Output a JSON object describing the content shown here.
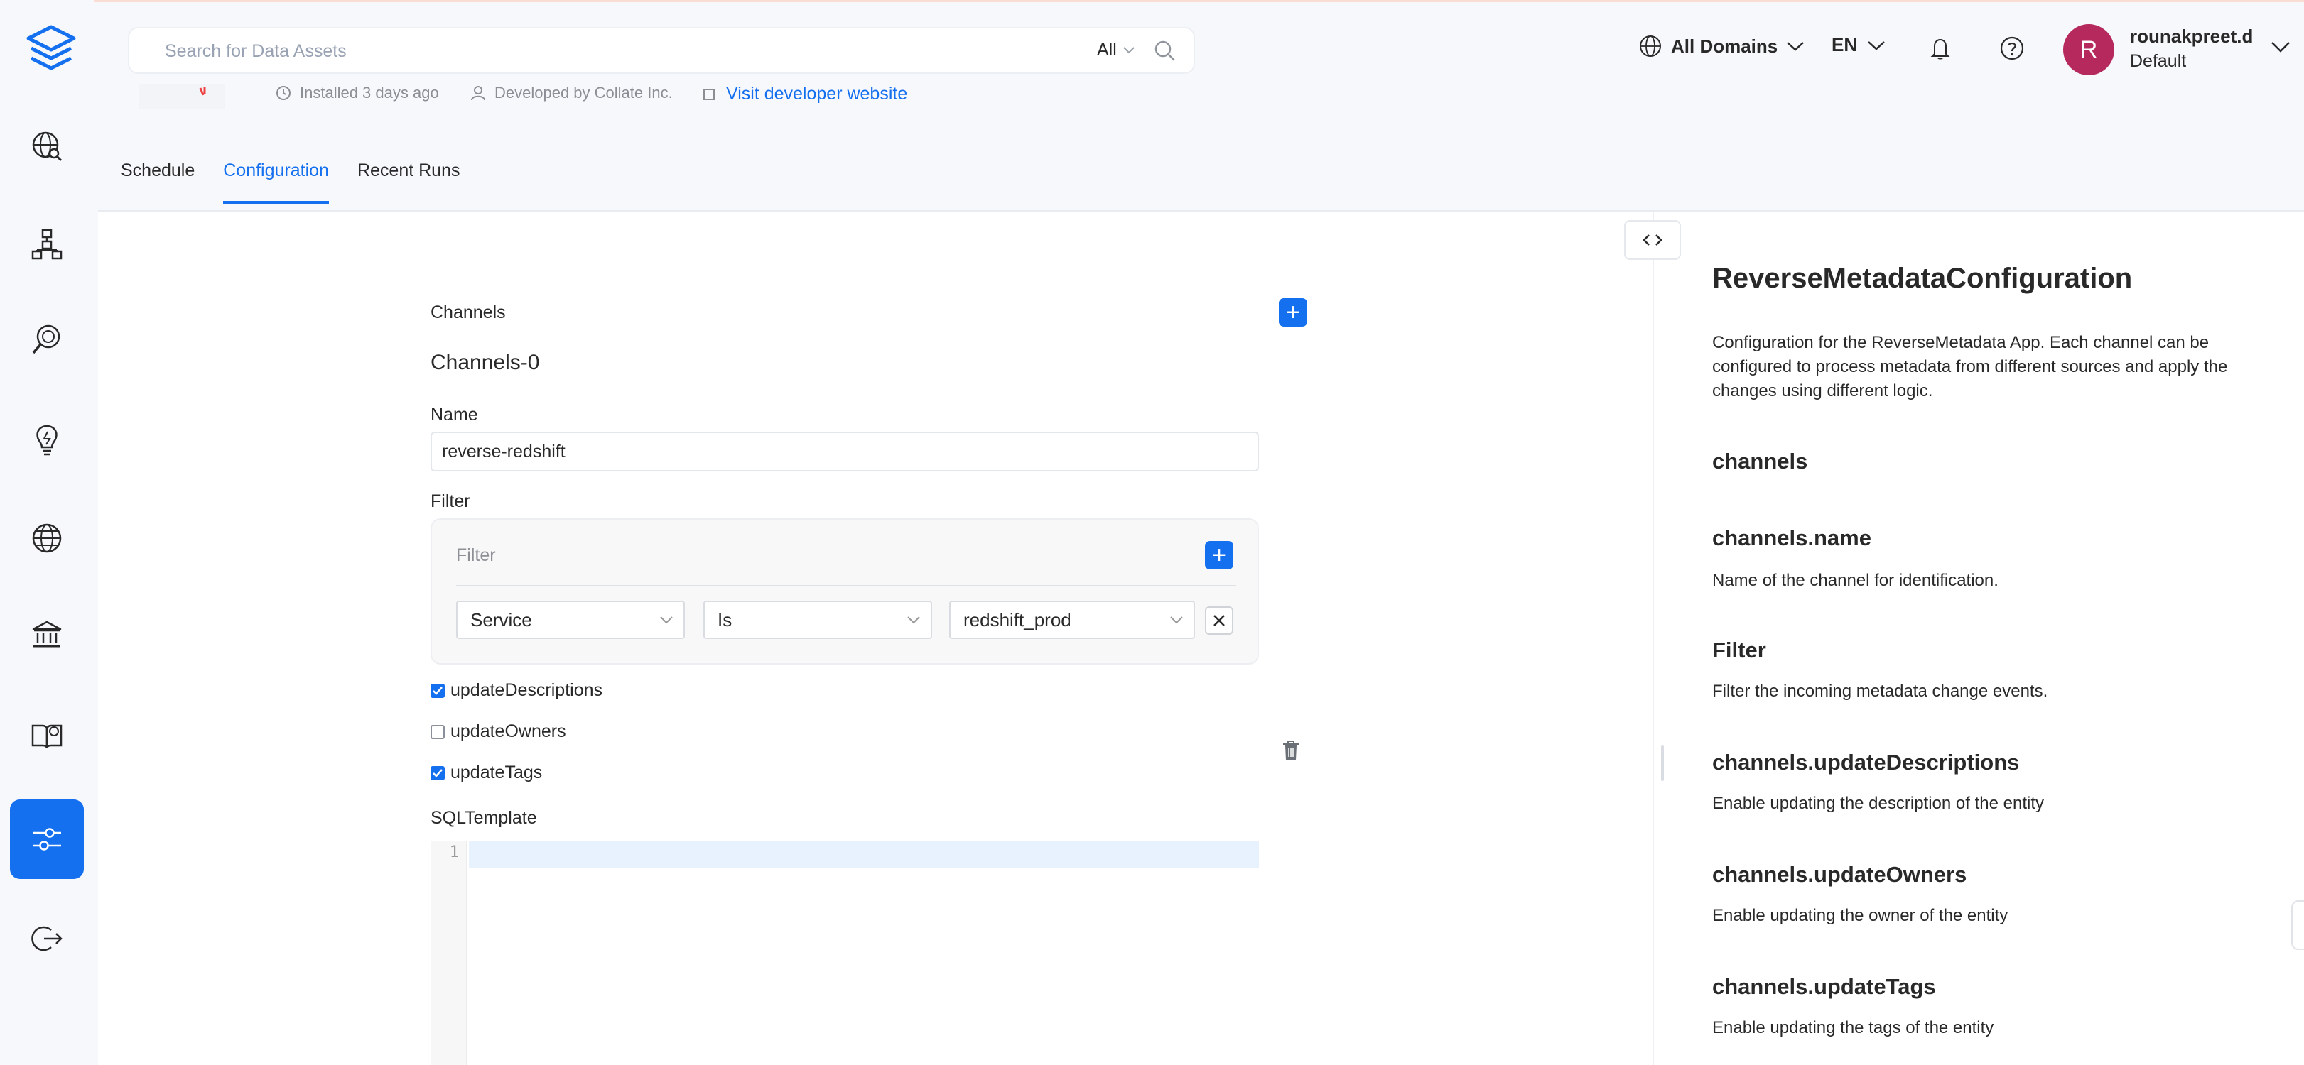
{
  "header": {
    "search_placeholder": "Search for Data Assets",
    "search_filter": "All",
    "domains": "All Domains",
    "language": "EN",
    "user": {
      "initial": "R",
      "name": "rounakpreet.d",
      "role": "Default"
    }
  },
  "app_meta": {
    "installed": "Installed 3 days ago",
    "developer": "Developed by Collate Inc.",
    "website": "Visit developer website"
  },
  "sidebar": {
    "items": [
      "explore-icon",
      "lineage-icon",
      "observability-icon",
      "insights-icon",
      "domains-icon",
      "governance-icon",
      "glossary-icon",
      "settings-icon",
      "logout-icon"
    ]
  },
  "tabs": [
    {
      "label": "Schedule"
    },
    {
      "label": "Configuration"
    },
    {
      "label": "Recent Runs"
    }
  ],
  "form": {
    "channels_label": "Channels",
    "channel_title": "Channels-0",
    "name_label": "Name",
    "name_value": "reverse-redshift",
    "filter_label": "Filter",
    "filter_header": "Filter",
    "filter_row": {
      "field": "Service",
      "operator": "Is",
      "value": "redshift_prod"
    },
    "checkboxes": [
      {
        "label": "updateDescriptions",
        "checked": true
      },
      {
        "label": "updateOwners",
        "checked": false
      },
      {
        "label": "updateTags",
        "checked": true
      }
    ],
    "sql_label": "SQLTemplate",
    "sql_line": "1"
  },
  "docs": {
    "title": "ReverseMetadataConfiguration",
    "description": "Configuration for the ReverseMetadata App. Each channel can be configured to process metadata from different sources and apply the changes using different logic.",
    "sections": [
      {
        "heading": "channels",
        "text": ""
      },
      {
        "heading": "channels.name",
        "text": "Name of the channel for identification."
      },
      {
        "heading": "Filter",
        "text": "Filter the incoming metadata change events."
      },
      {
        "heading": "channels.updateDescriptions",
        "text": "Enable updating the description of the entity"
      },
      {
        "heading": "channels.updateOwners",
        "text": "Enable updating the owner of the entity"
      },
      {
        "heading": "channels.updateTags",
        "text": "Enable updating the tags of the entity"
      }
    ]
  },
  "colors": {
    "accent": "#1570ef",
    "avatar": "#b5295c",
    "editor_active_line": "#e8f2ff"
  }
}
